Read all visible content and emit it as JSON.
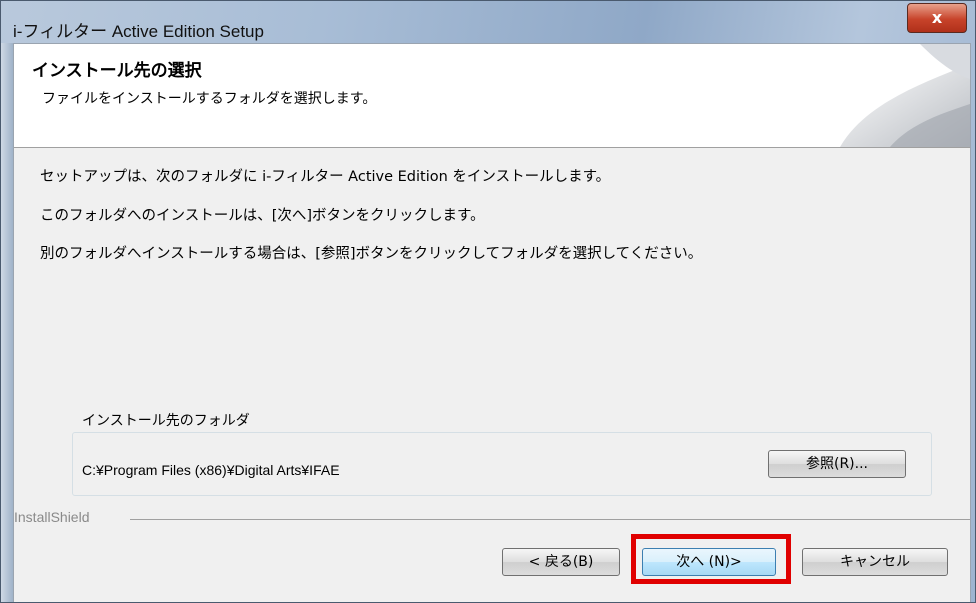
{
  "window": {
    "title": "i-フィルター Active Edition Setup",
    "close_label": "x"
  },
  "header": {
    "title": "インストール先の選択",
    "subtitle": "ファイルをインストールするフォルダを選択します。"
  },
  "body": {
    "line1": "セットアップは、次のフォルダに i-フィルター Active Edition をインストールします。",
    "line2": "このフォルダへのインストールは、[次へ]ボタンをクリックします。",
    "line3": "別のフォルダへインストールする場合は、[参照]ボタンをクリックしてフォルダを選択してください。"
  },
  "destination": {
    "group_label": "インストール先のフォルダ",
    "path": "C:¥Program Files (x86)¥Digital Arts¥IFAE",
    "browse_label": "参照(R)..."
  },
  "footer": {
    "brand": "InstallShield",
    "back_label": "< 戻る(B)",
    "next_label": "次へ (N)>",
    "cancel_label": "キャンセル"
  },
  "colors": {
    "highlight": "#e00000",
    "close_button": "#c7432a"
  }
}
